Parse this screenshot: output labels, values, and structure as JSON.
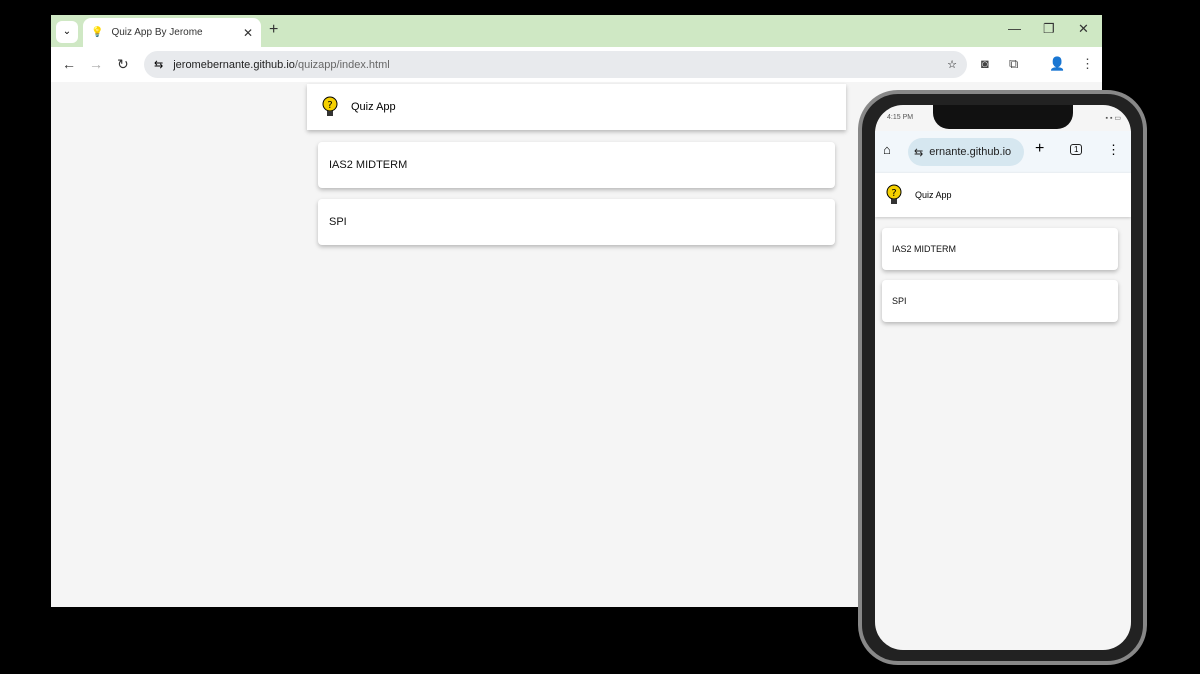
{
  "browser": {
    "tab_title": "Quiz App By Jerome",
    "url_host": "jeromebernante.github.io",
    "url_path": "/quizapp/index.html"
  },
  "app": {
    "title": "Quiz App",
    "quizzes": [
      {
        "label": "IAS2 MIDTERM"
      },
      {
        "label": "SPI"
      }
    ]
  },
  "phone": {
    "time": "4:15 PM",
    "url": "ernante.github.io",
    "tab_count": "1"
  }
}
